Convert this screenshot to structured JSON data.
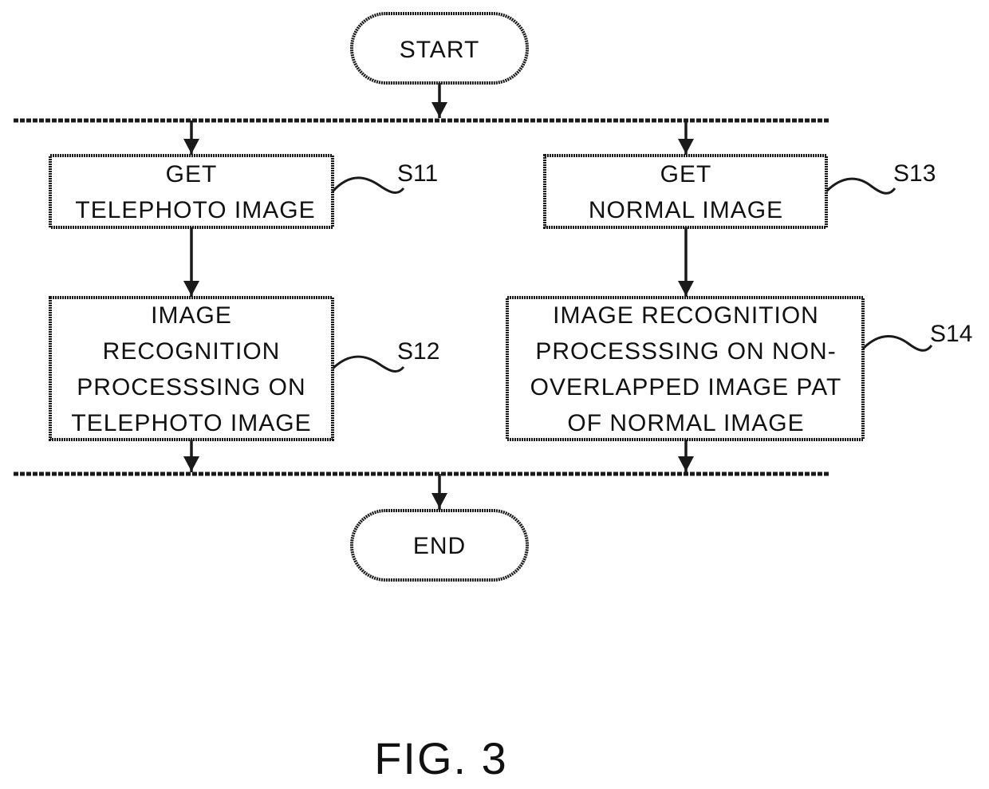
{
  "diagram": {
    "type": "flowchart",
    "caption": "FIG. 3",
    "nodes": [
      {
        "id": "start",
        "kind": "terminal",
        "lines": [
          "START"
        ]
      },
      {
        "id": "s11",
        "kind": "process",
        "step": "S11",
        "lines": [
          "GET",
          "TELEPHOTO IMAGE"
        ]
      },
      {
        "id": "s12",
        "kind": "process",
        "step": "S12",
        "lines": [
          "IMAGE",
          "RECOGNITION",
          "PROCESSSING ON",
          "TELEPHOTO IMAGE"
        ]
      },
      {
        "id": "s13",
        "kind": "process",
        "step": "S13",
        "lines": [
          "GET",
          "NORMAL IMAGE"
        ]
      },
      {
        "id": "s14",
        "kind": "process",
        "step": "S14",
        "lines": [
          "IMAGE RECOGNITION",
          "PROCESSSING ON NON-",
          "OVERLAPPED IMAGE PAT",
          "OF NORMAL IMAGE"
        ]
      },
      {
        "id": "end",
        "kind": "terminal",
        "lines": [
          "END"
        ]
      }
    ],
    "edges": [
      {
        "from": "start",
        "to": "fork"
      },
      {
        "from": "fork",
        "to": "s11"
      },
      {
        "from": "fork",
        "to": "s13"
      },
      {
        "from": "s11",
        "to": "s12"
      },
      {
        "from": "s13",
        "to": "s14"
      },
      {
        "from": "s12",
        "to": "join"
      },
      {
        "from": "s14",
        "to": "join"
      },
      {
        "from": "join",
        "to": "end"
      }
    ],
    "parallel_bars": [
      {
        "id": "fork",
        "role": "parallel-fork"
      },
      {
        "id": "join",
        "role": "parallel-join"
      }
    ]
  }
}
